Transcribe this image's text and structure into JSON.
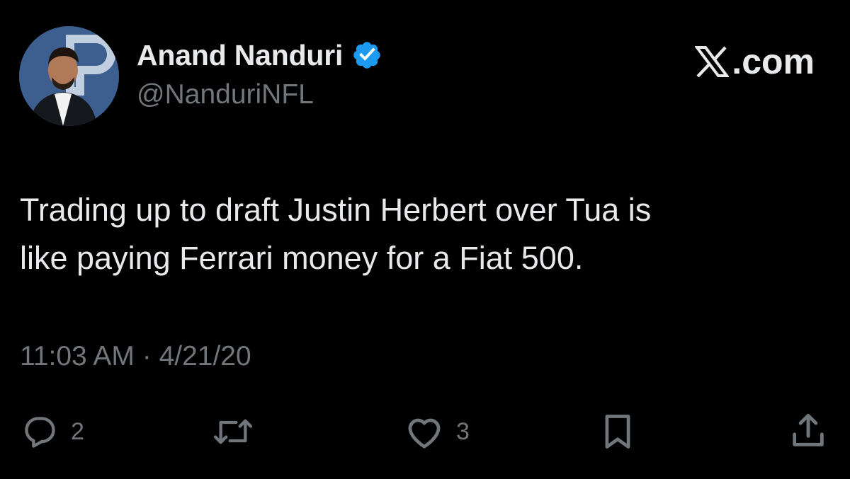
{
  "author": {
    "display_name": "Anand Nanduri",
    "handle": "@NanduriNFL",
    "verified": true,
    "verified_color": "#1d9bf0"
  },
  "brand": {
    "label": ".com"
  },
  "tweet": {
    "lines": [
      "Trading up to draft Justin Herbert over Tua is",
      "like paying Ferrari money for a Fiat 500."
    ],
    "time": "11:03 AM",
    "date": "4/21/20"
  },
  "actions": {
    "reply_count": "2",
    "like_count": "3"
  },
  "icons": {
    "avatar": "profile-photo",
    "verified": "verified-badge-icon",
    "brand": "x-logo-icon",
    "reply": "reply-icon",
    "retweet": "retweet-icon",
    "like": "heart-icon",
    "bookmark": "bookmark-icon",
    "share": "share-icon"
  },
  "colors": {
    "background": "#000000",
    "text": "#e7e9ea",
    "muted": "#71767b"
  }
}
